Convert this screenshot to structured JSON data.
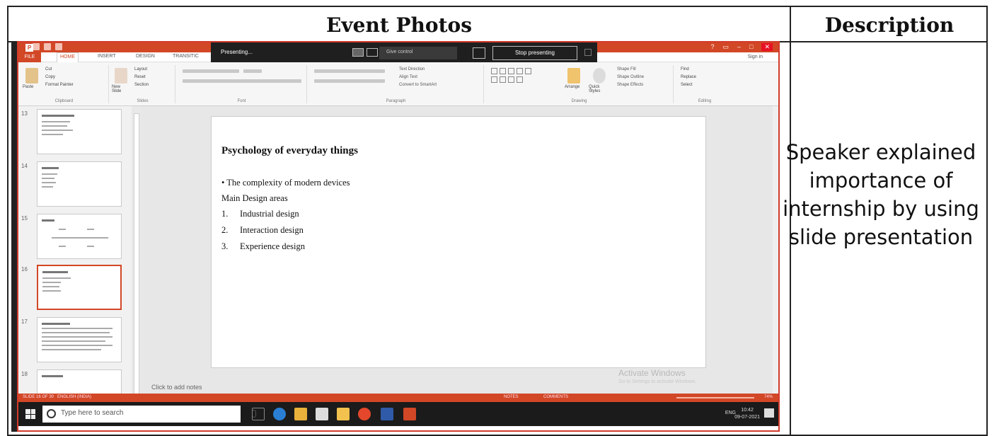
{
  "table": {
    "header_photos": "Event Photos",
    "header_description": "Description",
    "description": "Speaker explained importance of internship by using slide presentation"
  },
  "screenshot": {
    "tabs": [
      "FILE",
      "HOME",
      "INSERT",
      "DESIGN",
      "TRANSITIC"
    ],
    "sign_in": "Sign in",
    "presenting_bar": {
      "status": "Presenting...",
      "give_control": "Give control",
      "stop": "Stop presenting"
    },
    "ribbon": {
      "clipboard": {
        "cut": "Cut",
        "copy": "Copy",
        "paste": "Paste",
        "format_painter": "Format Painter",
        "group": "Clipboard"
      },
      "slides": {
        "new_slide": "New Slide",
        "layout": "Layout",
        "reset": "Reset",
        "section": "Section",
        "group": "Slides"
      },
      "font_group": "Font",
      "paragraph": {
        "text_direction": "Text Direction",
        "align_text": "Align Text",
        "convert": "Convert to SmartArt",
        "group": "Paragraph"
      },
      "drawing": {
        "arrange": "Arrange",
        "quick_styles": "Quick Styles",
        "shape_fill": "Shape Fill",
        "shape_outline": "Shape Outline",
        "shape_effects": "Shape Effects",
        "group": "Drawing"
      },
      "editing": {
        "find": "Find",
        "replace": "Replace",
        "select": "Select",
        "group": "Editing"
      }
    },
    "thumbnails": [
      "13",
      "14",
      "15",
      "16",
      "17",
      "18"
    ],
    "active_thumbnail": "16",
    "slide": {
      "title": "Psychology of everyday things",
      "bullet": "• The complexity of modern devices",
      "subheading": "Main Design areas",
      "items": [
        {
          "num": "1.",
          "text": "Industrial design"
        },
        {
          "num": "2.",
          "text": "Interaction design"
        },
        {
          "num": "3.",
          "text": "Experience design"
        }
      ]
    },
    "notes_placeholder": "Click to add notes",
    "activate_windows": "Activate Windows",
    "activate_sub": "Go to Settings to activate Windows.",
    "status": {
      "slide_of": "SLIDE 16 OF 30",
      "language": "ENGLISH (INDIA)",
      "notes": "NOTES",
      "comments": "COMMENTS",
      "zoom": "74%"
    },
    "taskbar": {
      "search_placeholder": "Type here to search",
      "lang": "ENG",
      "time": "10:42",
      "date": "09-07-2021"
    },
    "colors": {
      "accent": "#d24726",
      "taskbar": "#1b1b1b",
      "presenting_bar": "#1f1f1f"
    }
  }
}
